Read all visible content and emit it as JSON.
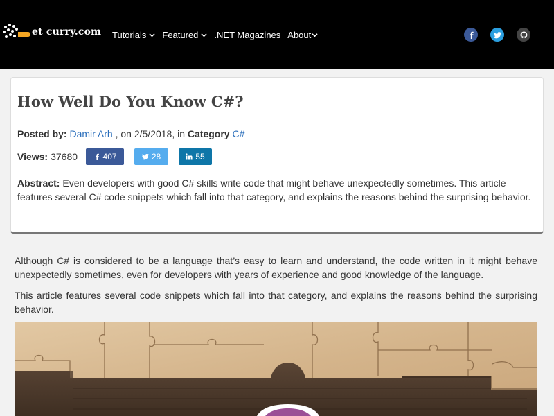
{
  "header": {
    "logo_text": "et curry.com",
    "nav": [
      {
        "label": "Tutorials",
        "has_dropdown": true
      },
      {
        "label": "Featured",
        "has_dropdown": true
      },
      {
        "label": ".NET Magazines",
        "has_dropdown": false
      },
      {
        "label": "About",
        "has_dropdown": true
      }
    ],
    "social": [
      {
        "icon": "facebook-icon",
        "color": "#3b5998"
      },
      {
        "icon": "twitter-icon",
        "color": "#2b9fe0"
      },
      {
        "icon": "github-icon",
        "color": "#444444"
      }
    ]
  },
  "article": {
    "title": "How Well Do You Know C#?",
    "posted_by_label": "Posted by:",
    "author": "Damir Arh",
    "date_text": " , on 2/5/2018, in ",
    "category_label": "Category",
    "category": "C#",
    "views_label": "Views:",
    "views": "37680",
    "shares": [
      {
        "network": "facebook",
        "count": "407",
        "color": "#3b5998"
      },
      {
        "network": "twitter",
        "count": "28",
        "color": "#55acee"
      },
      {
        "network": "linkedin",
        "count": "55",
        "color": "#0e76a8"
      }
    ],
    "abstract_label": "Abstract:",
    "abstract": " Even developers with good C# skills write code that might behave unexpectedly sometimes. This article features several C# code snippets which fall into that category, and explains the reasons behind the surprising behavior."
  },
  "body": {
    "p1": "Although C# is considered to be a language that’s easy to learn and understand, the code written in it might behave unexpectedly sometimes, even for developers with years of experience and good knowledge of the language.",
    "p2": "This article features several code snippets which fall into that category, and explains the reasons behind the surprising behavior."
  },
  "colors": {
    "header_bg": "#000000",
    "link": "#2a6ebb",
    "logo_accent": "#f5a623"
  }
}
